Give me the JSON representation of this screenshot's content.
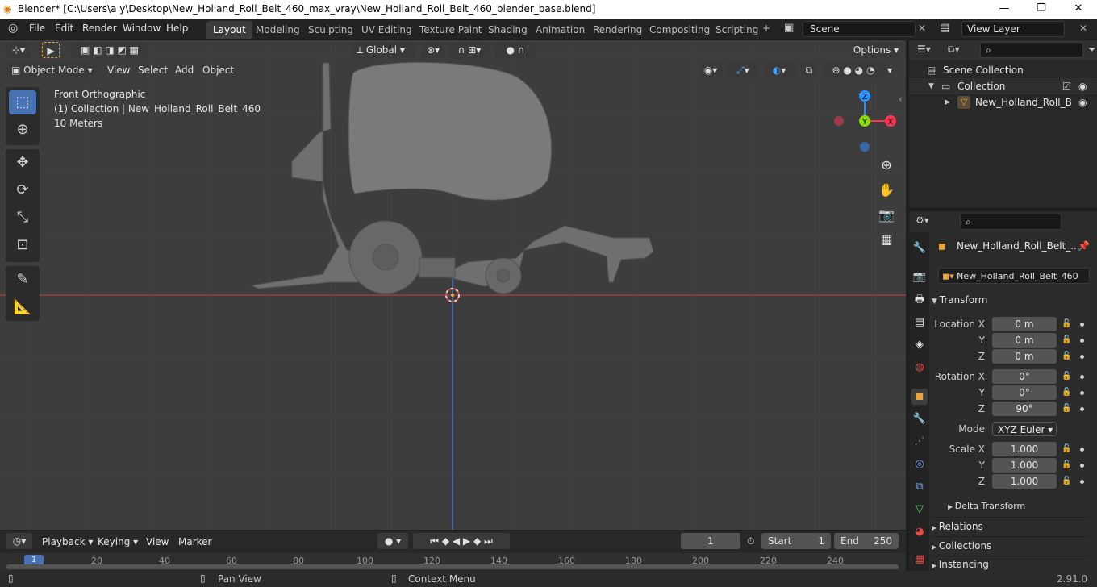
{
  "title": "Blender* [C:\\Users\\a y\\Desktop\\New_Holland_Roll_Belt_460_max_vray\\New_Holland_Roll_Belt_460_blender_base.blend]",
  "window_controls": {
    "minimize": "—",
    "maximize": "❐",
    "close": "✕"
  },
  "menu": [
    "File",
    "Edit",
    "Render",
    "Window",
    "Help"
  ],
  "workspaces": [
    "Layout",
    "Modeling",
    "Sculpting",
    "UV Editing",
    "Texture Paint",
    "Shading",
    "Animation",
    "Rendering",
    "Compositing",
    "Scripting"
  ],
  "active_workspace": "Layout",
  "scene": "Scene",
  "view_layer": "View Layer",
  "viewport": {
    "transform_orientation": "Global",
    "options_label": "Options",
    "mode": "Object Mode",
    "header_menus": [
      "View",
      "Select",
      "Add",
      "Object"
    ],
    "info_view": "Front Orthographic",
    "info_collection": "(1) Collection | New_Holland_Roll_Belt_460",
    "info_scale": "10 Meters",
    "gizmo": {
      "z": "Z",
      "y": "Y",
      "x": "X"
    }
  },
  "outliner": {
    "scene_collection": "Scene Collection",
    "collection": "Collection",
    "object": "New_Holland_Roll_B"
  },
  "properties": {
    "object_name_header": "New_Holland_Roll_Belt_...",
    "object_name_field": "New_Holland_Roll_Belt_460",
    "transform_label": "Transform",
    "location_label": "Location X",
    "rotation_label": "Rotation X",
    "scale_label": "Scale X",
    "y_label": "Y",
    "z_label": "Z",
    "location": {
      "x": "0 m",
      "y": "0 m",
      "z": "0 m"
    },
    "rotation": {
      "x": "0°",
      "y": "0°",
      "z": "90°"
    },
    "mode_label": "Mode",
    "mode_value": "XYZ Euler",
    "scale": {
      "x": "1.000",
      "y": "1.000",
      "z": "1.000"
    },
    "delta_transform": "Delta Transform",
    "relations": "Relations",
    "collections": "Collections",
    "instancing": "Instancing"
  },
  "timeline": {
    "menus": [
      "Playback",
      "Keying",
      "View",
      "Marker"
    ],
    "current_frame": "1",
    "start_label": "Start",
    "start_value": "1",
    "end_label": "End",
    "end_value": "250",
    "ruler": [
      "1",
      "20",
      "40",
      "60",
      "80",
      "100",
      "120",
      "140",
      "160",
      "180",
      "200",
      "220",
      "240"
    ]
  },
  "statusbar": {
    "pan": "Pan View",
    "context": "Context Menu",
    "version": "2.91.0"
  },
  "colors": {
    "accent": "#4772b3",
    "x_axis": "#ff3352",
    "y_axis": "#8bdc00",
    "z_axis": "#2890ff",
    "active_object": "#e8a33d"
  }
}
